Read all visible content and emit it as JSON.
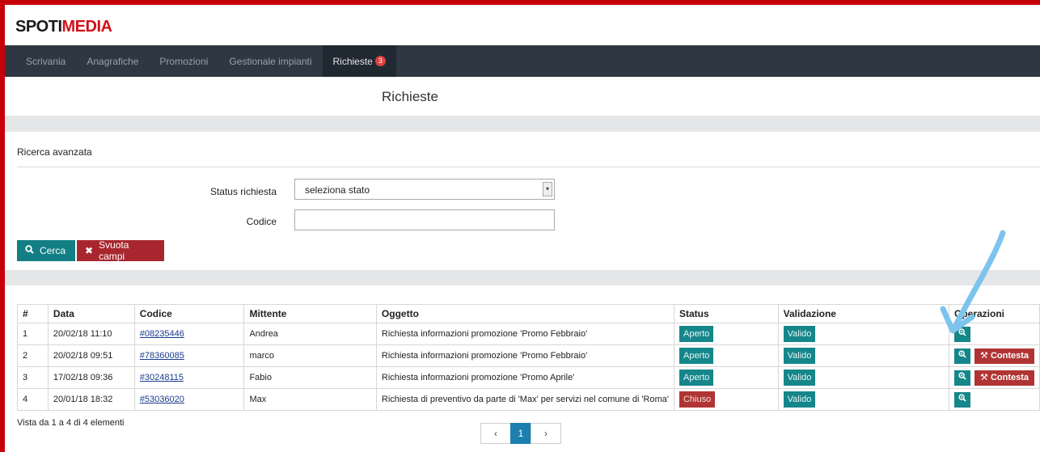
{
  "brand": {
    "name_main": "SPOTI",
    "name_accent": "MEDIA"
  },
  "nav": {
    "items": [
      {
        "label": "Scrivania"
      },
      {
        "label": "Anagrafiche"
      },
      {
        "label": "Promozioni"
      },
      {
        "label": "Gestionale impianti"
      },
      {
        "label": "Richieste",
        "badge": "3"
      }
    ],
    "active": "Richieste"
  },
  "page": {
    "title": "Richieste"
  },
  "search": {
    "section_label": "Ricerca avanzata",
    "status_label": "Status richiesta",
    "status_value": "seleziona stato",
    "code_label": "Codice",
    "code_value": "",
    "search_button": "Cerca",
    "clear_button": "Svuota campi"
  },
  "table": {
    "columns": [
      "#",
      "Data",
      "Codice",
      "Mittente",
      "Oggetto",
      "Status",
      "Validazione",
      "Operazioni"
    ],
    "rows": [
      {
        "n": "1",
        "data": "20/02/18 11:10",
        "codice": "#08235446",
        "mittente": "Andrea",
        "oggetto": "Richiesta informazioni promozione 'Promo Febbraio'",
        "status": "Aperto",
        "validazione": "Valido",
        "contesta": ""
      },
      {
        "n": "2",
        "data": "20/02/18 09:51",
        "codice": "#78360085",
        "mittente": "marco",
        "oggetto": "Richiesta informazioni promozione 'Promo Febbraio'",
        "status": "Aperto",
        "validazione": "Valido",
        "contesta": "Contesta"
      },
      {
        "n": "3",
        "data": "17/02/18 09:36",
        "codice": "#30248115",
        "mittente": "Fabio",
        "oggetto": "Richiesta informazioni promozione 'Promo Aprile'",
        "status": "Aperto",
        "validazione": "Valido",
        "contesta": "Contesta"
      },
      {
        "n": "4",
        "data": "20/01/18 18:32",
        "codice": "#53036020",
        "mittente": "Max",
        "oggetto": "Richiesta di preventivo da parte di 'Max' per servizi nel comune di 'Roma'",
        "status": "Chiuso",
        "validazione": "Valido",
        "contesta": ""
      }
    ]
  },
  "footer": {
    "info": "Vista da 1 a 4 di 4 elementi"
  },
  "pagination": {
    "prev": "‹",
    "current": "1",
    "next": "›"
  },
  "colors": {
    "frame": "#c8000a",
    "navbar": "#2f3742",
    "teal": "#15868a",
    "red": "#b03434",
    "annotation_arrow": "#7cc4ee"
  }
}
